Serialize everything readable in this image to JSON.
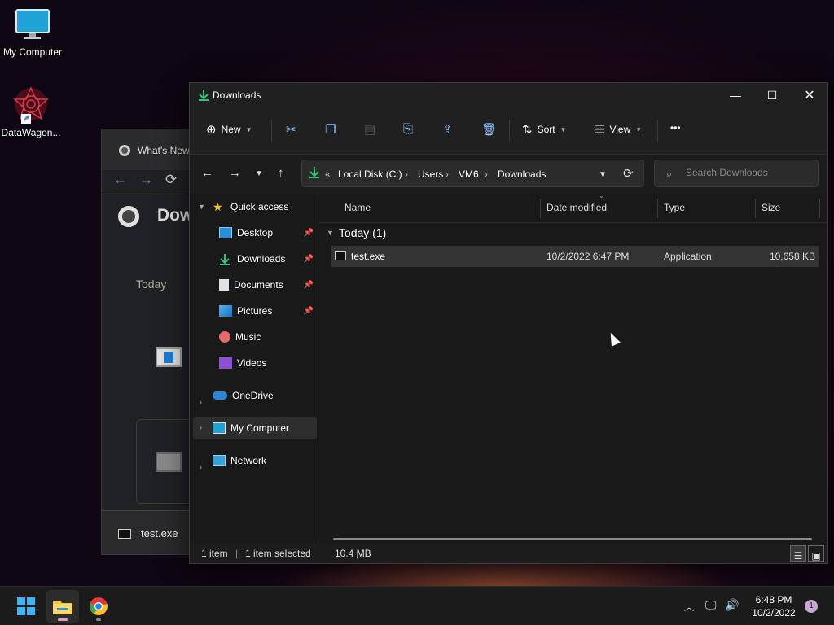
{
  "desktop": {
    "icons": [
      {
        "label": "My Computer"
      },
      {
        "label": "DataWagon..."
      }
    ]
  },
  "browser": {
    "tab_title": "What's New",
    "page_title": "Dow",
    "today_label": "Today",
    "bottom_file": "test.exe"
  },
  "explorer": {
    "title": "Downloads",
    "toolbar": {
      "new_label": "New",
      "sort_label": "Sort",
      "view_label": "View",
      "more_label": "•••"
    },
    "address": {
      "overflow": "«",
      "crumbs": [
        "Local Disk (C:)",
        "Users",
        "VM6",
        "Downloads"
      ],
      "separator": "›"
    },
    "search_placeholder": "Search Downloads",
    "nav": {
      "quick_access": "Quick access",
      "items": [
        {
          "label": "Desktop",
          "pinned": true
        },
        {
          "label": "Downloads",
          "pinned": true
        },
        {
          "label": "Documents",
          "pinned": true
        },
        {
          "label": "Pictures",
          "pinned": true
        },
        {
          "label": "Music",
          "pinned": false
        },
        {
          "label": "Videos",
          "pinned": false
        }
      ],
      "onedrive": "OneDrive",
      "my_computer": "My Computer",
      "network": "Network"
    },
    "columns": [
      "Name",
      "Date modified",
      "Type",
      "Size"
    ],
    "group_label": "Today (1)",
    "files": [
      {
        "name": "test.exe",
        "date": "10/2/2022 6:47 PM",
        "type": "Application",
        "size": "10,658 KB"
      }
    ],
    "status": {
      "count": "1 item",
      "selected": "1 item selected",
      "size": "10.4 MB"
    }
  },
  "taskbar": {
    "time": "6:48 PM",
    "date": "10/2/2022",
    "notifications": "1"
  }
}
